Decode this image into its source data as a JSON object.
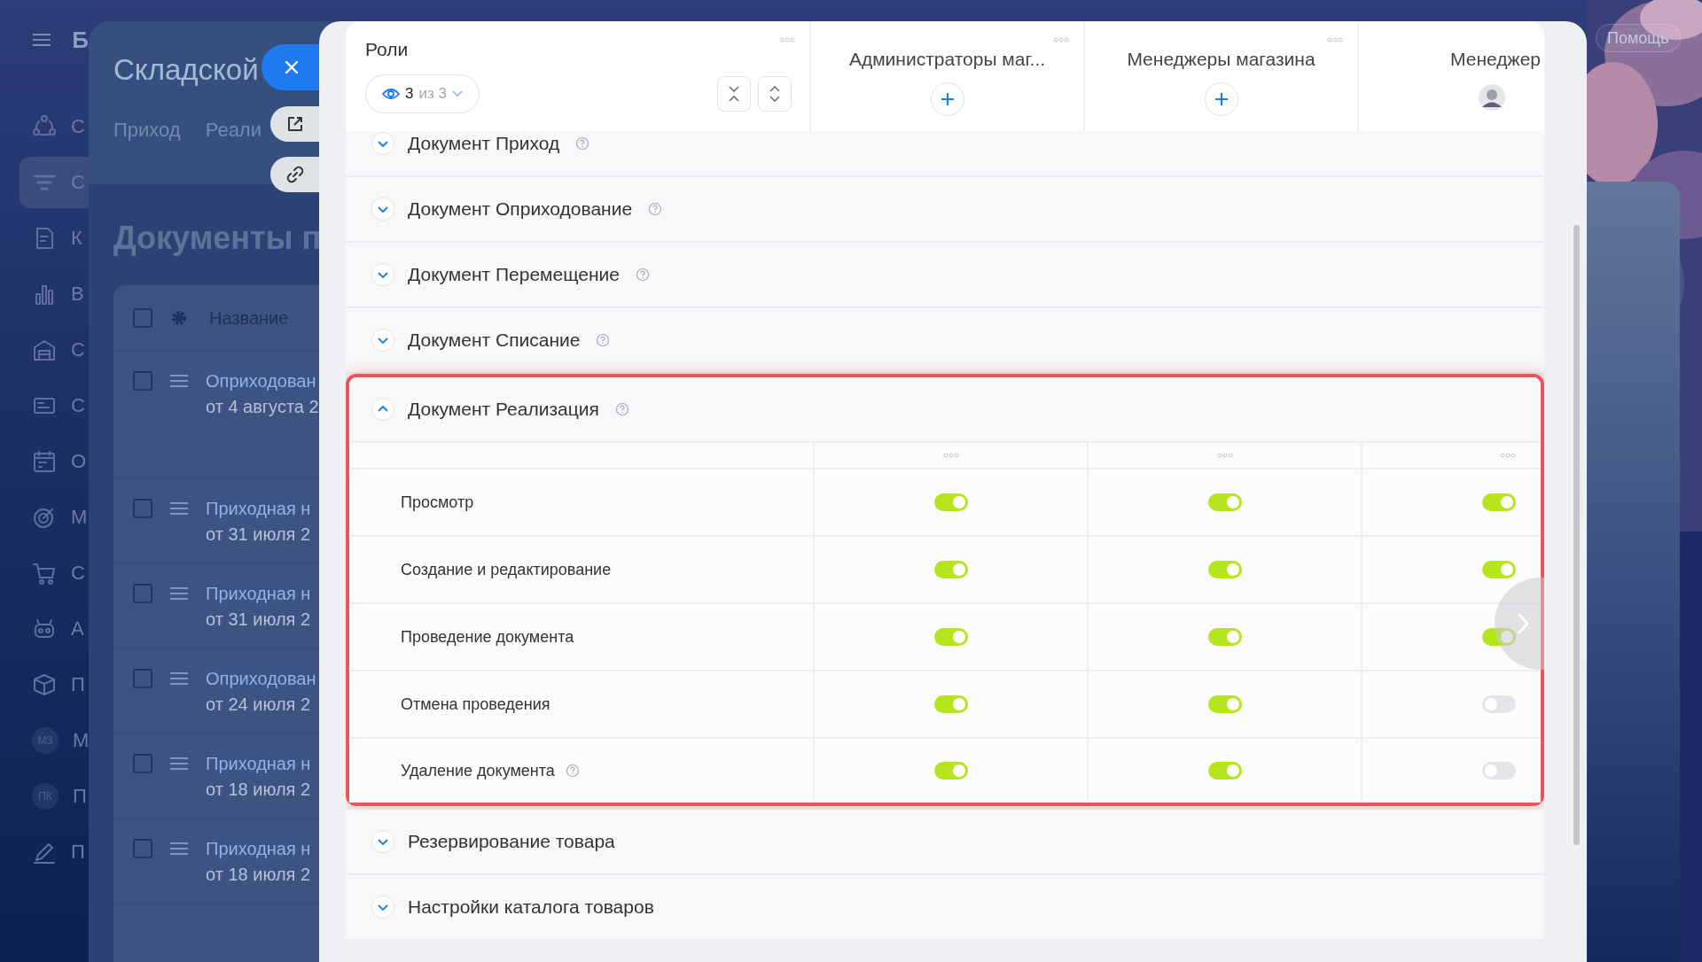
{
  "sidebar": {
    "logo": "Б",
    "items": [
      {
        "kind": "icon",
        "label": "С",
        "selected": false
      },
      {
        "kind": "icon",
        "label": "С",
        "selected": true
      },
      {
        "kind": "icon",
        "label": "К",
        "selected": false
      },
      {
        "kind": "icon",
        "label": "В",
        "selected": false
      },
      {
        "kind": "icon",
        "label": "С",
        "selected": false
      },
      {
        "kind": "icon",
        "label": "С",
        "selected": false
      },
      {
        "kind": "icon",
        "label": "О",
        "selected": false
      },
      {
        "kind": "icon",
        "label": "М",
        "selected": false
      },
      {
        "kind": "icon",
        "label": "С",
        "selected": false
      },
      {
        "kind": "icon",
        "label": "А",
        "selected": false
      },
      {
        "kind": "icon",
        "label": "П",
        "selected": false
      },
      {
        "kind": "badge",
        "badge": "МЗ",
        "label": "М",
        "selected": false
      },
      {
        "kind": "badge",
        "badge": "ПК",
        "label": "П",
        "selected": false
      },
      {
        "kind": "icon",
        "label": "П",
        "selected": false
      }
    ]
  },
  "background_page": {
    "title": "Складской",
    "tabs": [
      {
        "label": "Приход"
      },
      {
        "label": "Реали"
      }
    ],
    "heading": "Документы п",
    "table": {
      "select_all_checked": false,
      "columns": [
        "Название"
      ],
      "rows": [
        {
          "title": "Оприходован",
          "date": "от 4 августа 2",
          "checked": false
        },
        {
          "title": "Приходная н",
          "date": "от 31 июля 2",
          "checked": false
        },
        {
          "title": "Приходная н",
          "date": "от 31 июля 2",
          "checked": false
        },
        {
          "title": "Оприходован",
          "date": "от 24 июля 2",
          "checked": false
        },
        {
          "title": "Приходная н",
          "date": "от 18 июля 2",
          "checked": false
        },
        {
          "title": "Приходная н",
          "date": "от 18 июля 2",
          "checked": false
        }
      ]
    }
  },
  "help_button": "Помощь",
  "roles_panel": {
    "title": "Роли",
    "visible_count": "3",
    "visible_total": "из 3",
    "roles": [
      {
        "name": "Администраторы маг...",
        "kind": "add"
      },
      {
        "name": "Менеджеры магазина",
        "kind": "add"
      },
      {
        "name": "Менеджер",
        "kind": "avatar"
      }
    ],
    "sections": [
      {
        "title": "Документ Приход",
        "help": true,
        "expanded": false,
        "highlighted": false
      },
      {
        "title": "Документ Оприходование",
        "help": true,
        "expanded": false,
        "highlighted": false
      },
      {
        "title": "Документ Перемещение",
        "help": true,
        "expanded": false,
        "highlighted": false
      },
      {
        "title": "Документ Списание",
        "help": true,
        "expanded": false,
        "highlighted": false
      },
      {
        "title": "Документ Реализация",
        "help": true,
        "expanded": true,
        "highlighted": true,
        "permissions": [
          {
            "label": "Просмотр",
            "help": false,
            "values": [
              true,
              true,
              true
            ]
          },
          {
            "label": "Создание и редактирование",
            "help": false,
            "values": [
              true,
              true,
              true
            ]
          },
          {
            "label": "Проведение документа",
            "help": false,
            "values": [
              true,
              true,
              true
            ]
          },
          {
            "label": "Отмена проведения",
            "help": false,
            "values": [
              true,
              true,
              false
            ]
          },
          {
            "label": "Удаление документа",
            "help": true,
            "values": [
              true,
              true,
              false
            ]
          }
        ]
      },
      {
        "title": "Резервирование товара",
        "help": false,
        "expanded": false,
        "highlighted": false
      },
      {
        "title": "Настройки каталога товаров",
        "help": false,
        "expanded": false,
        "highlighted": false
      }
    ]
  }
}
